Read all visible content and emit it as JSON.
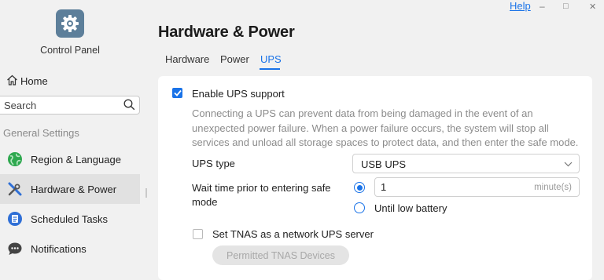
{
  "window": {
    "help_label": "Help",
    "minimize": "–",
    "maximize": "□",
    "close": "✕"
  },
  "sidebar": {
    "app_title": "Control Panel",
    "home_label": "Home",
    "search_placeholder": "Search",
    "group_label": "General Settings",
    "items": [
      {
        "label": "Region & Language",
        "icon": "globe-icon"
      },
      {
        "label": "Hardware & Power",
        "icon": "tools-icon",
        "active": true
      },
      {
        "label": "Scheduled Tasks",
        "icon": "task-list-icon"
      },
      {
        "label": "Notifications",
        "icon": "chat-bubble-icon"
      }
    ]
  },
  "main": {
    "title": "Hardware & Power",
    "tabs": [
      {
        "label": "Hardware"
      },
      {
        "label": "Power"
      },
      {
        "label": "UPS",
        "active": true
      }
    ]
  },
  "ups": {
    "enable_label": "Enable UPS support",
    "enable_checked": true,
    "description": "Connecting a UPS can prevent data from being damaged in the event of an unexpected power failure. When a power failure occurs, the system will stop all services and unload all storage spaces to protect data, and then enter the safe mode.",
    "type_label": "UPS type",
    "type_value": "USB UPS",
    "wait_label": "Wait time prior to entering safe mode",
    "wait_value": "1",
    "wait_unit": "minute(s)",
    "wait_option_selected": "minutes",
    "until_low_battery_label": "Until low battery",
    "network_server_label": "Set TNAS as a network UPS server",
    "network_server_checked": false,
    "permitted_button_label": "Permitted TNAS Devices"
  },
  "colors": {
    "accent": "#1a73e8",
    "sidebar_bg": "#f1f1f1",
    "active_item_bg": "#e1e1e1"
  }
}
